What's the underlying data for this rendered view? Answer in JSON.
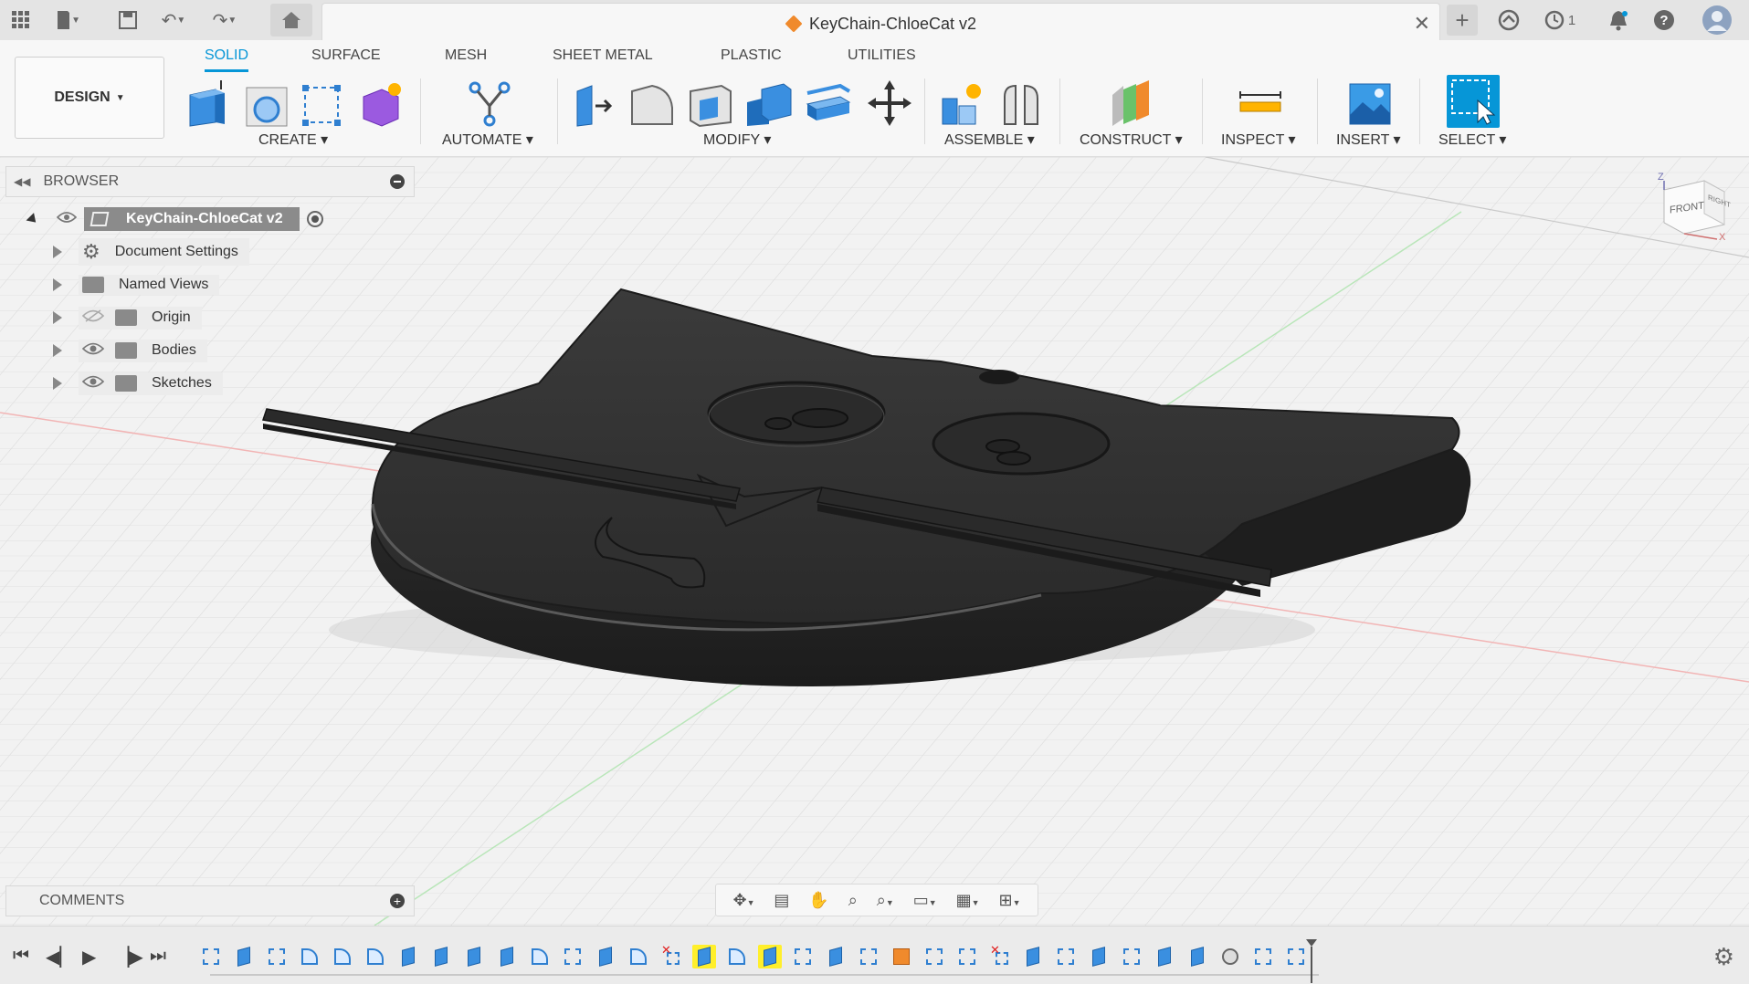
{
  "app": {
    "document_title": "KeyChain-ChloeCat v2",
    "notification_count": "1",
    "accent_color": "#0696d7",
    "icons": [
      "apps-grid-icon",
      "file-icon",
      "save-icon",
      "undo-icon",
      "redo-icon",
      "home-icon",
      "add-tab-icon",
      "extensions-icon",
      "job-status-icon",
      "notifications-icon",
      "help-icon",
      "user-avatar-icon"
    ]
  },
  "ribbon": {
    "workspace": "DESIGN",
    "tabs": [
      {
        "label": "SOLID",
        "active": true
      },
      {
        "label": "SURFACE",
        "active": false
      },
      {
        "label": "MESH",
        "active": false
      },
      {
        "label": "SHEET METAL",
        "active": false
      },
      {
        "label": "PLASTIC",
        "active": false
      },
      {
        "label": "UTILITIES",
        "active": false
      }
    ],
    "groups": {
      "create": "CREATE",
      "automate": "AUTOMATE",
      "modify": "MODIFY",
      "assemble": "ASSEMBLE",
      "construct": "CONSTRUCT",
      "inspect": "INSPECT",
      "insert": "INSERT",
      "select": "SELECT"
    }
  },
  "browser": {
    "title": "BROWSER",
    "root": "KeyChain-ChloeCat v2",
    "items": [
      {
        "label": "Document Settings",
        "icon": "gear-icon"
      },
      {
        "label": "Named Views",
        "icon": "folder-icon"
      },
      {
        "label": "Origin",
        "icon": "folder-icon",
        "visibility": "hidden"
      },
      {
        "label": "Bodies",
        "icon": "folder-icon",
        "visibility": "visible"
      },
      {
        "label": "Sketches",
        "icon": "folder-icon",
        "visibility": "visible"
      }
    ]
  },
  "viewcube": {
    "face": "FRONT",
    "side": "RIGHT",
    "axis_z": "Z",
    "axis_x": "X"
  },
  "comments": {
    "title": "COMMENTS"
  },
  "timeline": {
    "features": [
      "sketch",
      "extrude",
      "sketch",
      "fillet",
      "fillet",
      "fillet",
      "extrude",
      "extrude",
      "extrude",
      "extrude",
      "fillet",
      "sketch",
      "extrude",
      "fillet",
      "error",
      "extrude-hl",
      "fillet",
      "extrude-hl",
      "sketch",
      "extrude",
      "sketch",
      "combine",
      "sketch",
      "sketch",
      "error",
      "extrude",
      "sketch",
      "extrude",
      "sketch",
      "extrude",
      "extrude",
      "construct",
      "sketch",
      "sketch"
    ]
  }
}
